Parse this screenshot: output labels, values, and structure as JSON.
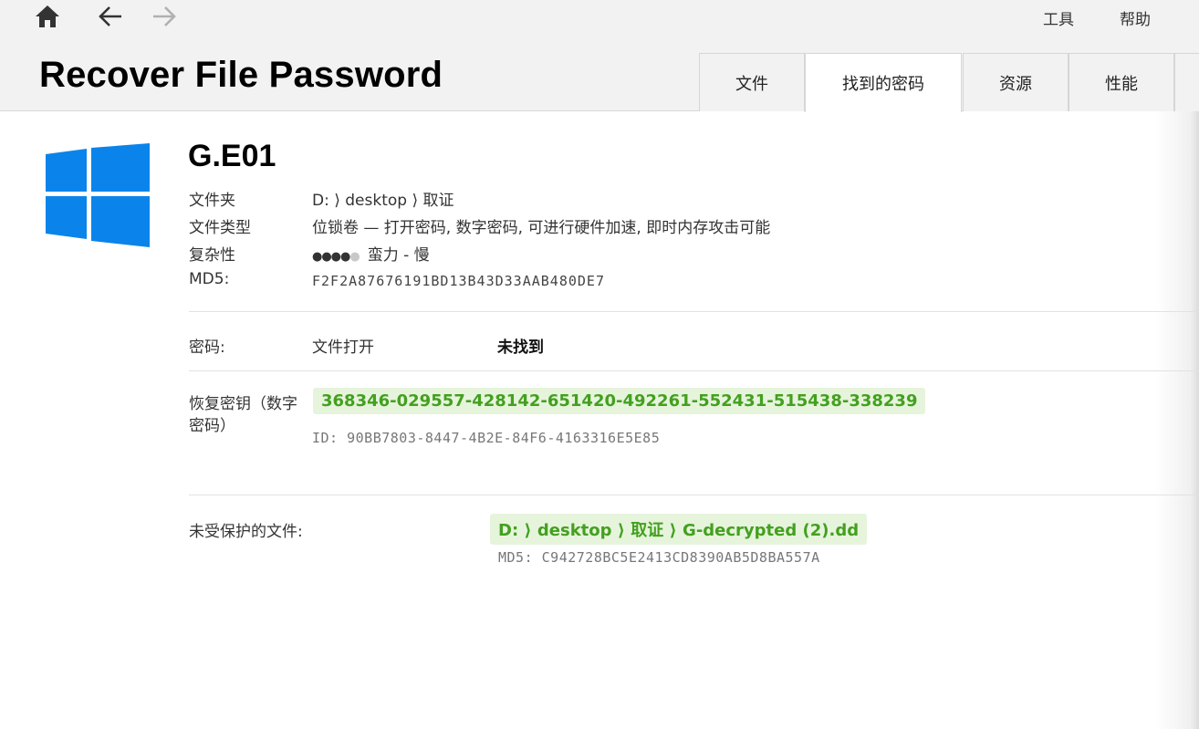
{
  "menu": {
    "tools": "工具",
    "help": "帮助"
  },
  "app_title": "Recover File Password",
  "tabs": [
    {
      "label": "文件",
      "active": false
    },
    {
      "label": "找到的密码",
      "active": true
    },
    {
      "label": "资源",
      "active": false
    },
    {
      "label": "性能",
      "active": false
    }
  ],
  "file": {
    "name": "G.E01",
    "folder_label": "文件夹",
    "folder_value": "D: ⟩ desktop ⟩ 取证",
    "type_label": "文件类型",
    "type_value": "位锁卷 — 打开密码, 数字密码, 可进行硬件加速, 即时内存攻击可能",
    "complexity_label": "复杂性",
    "complexity_dots": "●●●●",
    "complexity_dot_empty": "●",
    "complexity_value": "蛮力 - 慢",
    "complexity_level": 4,
    "complexity_max": 5,
    "md5_label": "MD5:",
    "md5_value": "F2F2A87676191BD13B43D33AAB480DE7"
  },
  "password": {
    "label": "密码:",
    "kind": "文件打开",
    "status": "未找到"
  },
  "recovery_key": {
    "label": "恢复密钥（数字密码）",
    "value": "368346-029557-428142-651420-492261-552431-515438-338239",
    "id": "ID: 90BB7803-8447-4B2E-84F6-4163316E5E85"
  },
  "unprotected": {
    "label": "未受保护的文件:",
    "path": "D: ⟩ desktop ⟩ 取证 ⟩ G-decrypted (2).dd",
    "md5": "MD5: C942728BC5E2413CD8390AB5D8BA557A"
  },
  "colors": {
    "accent_green": "#43a01f",
    "chip_bg": "#e6f4dc",
    "windows_blue": "#0a84ea"
  }
}
